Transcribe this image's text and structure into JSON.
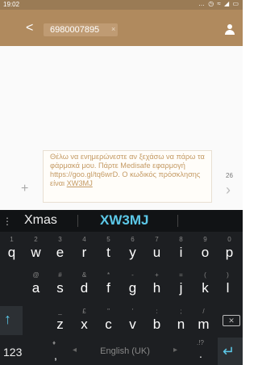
{
  "status_bar": {
    "time": "19:02",
    "icons": [
      "dots-icon",
      "alarm-icon",
      "wifi-icon",
      "signal-icon",
      "battery-icon"
    ]
  },
  "header": {
    "back_icon": "arrow-left-icon",
    "recipient": "6980007895",
    "chip_close": "×",
    "contact_icon": "person-icon",
    "color": "#b08a5e"
  },
  "compose": {
    "attach_icon": "plus-icon",
    "message_body": "Θέλω να ενημερώνεστε αν ξεχάσω να πάρω τα φάρμακά μου. Πάρτε Medisafe εφαρμογή https://goo.gl/tq6wrD. Ο κωδικός πρόσκλησης είναι ",
    "message_code": "XW3MJ",
    "char_counter": "26",
    "send_icon": "chevron-right-icon",
    "text_color": "#c49a63"
  },
  "keyboard": {
    "suggestions": [
      "Xmas",
      "XW3MJ"
    ],
    "suggestion_highlight_color": "#5cc8e8",
    "row1": [
      {
        "hint": "1",
        "key": "q"
      },
      {
        "hint": "2",
        "key": "w"
      },
      {
        "hint": "3",
        "key": "e"
      },
      {
        "hint": "4",
        "key": "r"
      },
      {
        "hint": "5",
        "key": "t"
      },
      {
        "hint": "6",
        "key": "y"
      },
      {
        "hint": "7",
        "key": "u"
      },
      {
        "hint": "8",
        "key": "i"
      },
      {
        "hint": "9",
        "key": "o"
      },
      {
        "hint": "0",
        "key": "p"
      }
    ],
    "row2": [
      {
        "hint": "@",
        "key": "a"
      },
      {
        "hint": "#",
        "key": "s"
      },
      {
        "hint": "&",
        "key": "d"
      },
      {
        "hint": "*",
        "key": "f"
      },
      {
        "hint": "-",
        "key": "g"
      },
      {
        "hint": "+",
        "key": "h"
      },
      {
        "hint": "=",
        "key": "j"
      },
      {
        "hint": "(",
        "key": "k"
      },
      {
        "hint": ")",
        "key": "l"
      }
    ],
    "row3": [
      {
        "hint": "_",
        "key": "z"
      },
      {
        "hint": "£",
        "key": "x"
      },
      {
        "hint": "\"",
        "key": "c"
      },
      {
        "hint": "'",
        "key": "v"
      },
      {
        "hint": ":",
        "key": "b"
      },
      {
        "hint": ";",
        "key": "n"
      },
      {
        "hint": "/",
        "key": "m"
      }
    ],
    "shift_icon": "shift-arrow-icon",
    "backspace_icon": "backspace-icon",
    "symbols_label": "123",
    "comma_label": ",",
    "mic_icon": "mic-icon",
    "space_label": "English (UK)",
    "period_hint": ".!?",
    "period_label": ".",
    "enter_icon": "enter-arrow-icon"
  }
}
